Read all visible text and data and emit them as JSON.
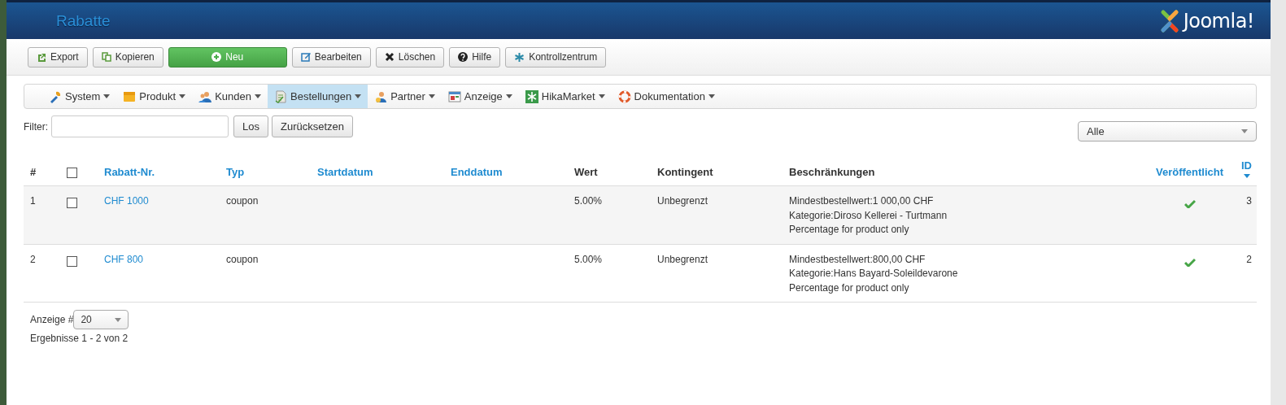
{
  "header": {
    "title": "Rabatte",
    "logo_text": "Joomla!"
  },
  "toolbar": [
    {
      "label": "Export",
      "kind": "default"
    },
    {
      "label": "Kopieren",
      "kind": "default"
    },
    {
      "label": "Neu",
      "kind": "primary"
    },
    {
      "label": "Bearbeiten",
      "kind": "default"
    },
    {
      "label": "Löschen",
      "kind": "default"
    },
    {
      "label": "Hilfe",
      "kind": "default"
    },
    {
      "label": "Kontrollzentrum",
      "kind": "default"
    }
  ],
  "menu": [
    {
      "label": "System",
      "selected": false
    },
    {
      "label": "Produkt",
      "selected": false
    },
    {
      "label": "Kunden",
      "selected": false
    },
    {
      "label": "Bestellungen",
      "selected": true
    },
    {
      "label": "Partner",
      "selected": false
    },
    {
      "label": "Anzeige",
      "selected": false
    },
    {
      "label": "HikaMarket",
      "selected": false
    },
    {
      "label": "Dokumentation",
      "selected": false
    }
  ],
  "filter": {
    "label": "Filter:",
    "buttons": [
      "Los",
      "Zurücksetzen"
    ],
    "select": "Alle"
  },
  "table": {
    "columns": [
      {
        "label": "#",
        "link": false,
        "sorted": false
      },
      {
        "kind": "checkbox",
        "checked": false
      },
      {
        "label": "Rabatt-Nr.",
        "link": true,
        "sorted": false
      },
      {
        "label": "Typ",
        "link": true,
        "sorted": false
      },
      {
        "label": "Startdatum",
        "link": true,
        "sorted": false
      },
      {
        "label": "Enddatum",
        "link": true,
        "sorted": false
      },
      {
        "label": "Wert",
        "link": false,
        "sorted": false
      },
      {
        "label": "Kontingent",
        "link": false,
        "sorted": false
      },
      {
        "label": "Beschränkungen",
        "link": false,
        "sorted": false
      },
      {
        "label": "Veröffentlicht",
        "link": true,
        "sorted": false
      },
      {
        "label": "ID",
        "link": true,
        "sorted": true
      }
    ],
    "rows": [
      {
        "number": "1",
        "checked": false,
        "code": "CHF 1000",
        "type": "coupon",
        "value": "5.00%",
        "quota": "Unbegrenzt",
        "restrictions": [
          "Mindestbestellwert:1 000,00 CHF",
          "Kategorie:Diroso Kellerei - Turtmann",
          "Percentage for product only"
        ],
        "published": true,
        "id": "3"
      },
      {
        "number": "2",
        "checked": false,
        "code": "CHF 800",
        "type": "coupon",
        "value": "5.00%",
        "quota": "Unbegrenzt",
        "restrictions": [
          "Mindestbestellwert:800,00 CHF",
          "Kategorie:Hans Bayard-Soleildevarone",
          "Percentage for product only"
        ],
        "published": true,
        "id": "2"
      }
    ]
  },
  "footer": {
    "display_label": "Anzeige #",
    "display_value": "20",
    "results": "Ergebnisse 1 - 2 von 2"
  }
}
